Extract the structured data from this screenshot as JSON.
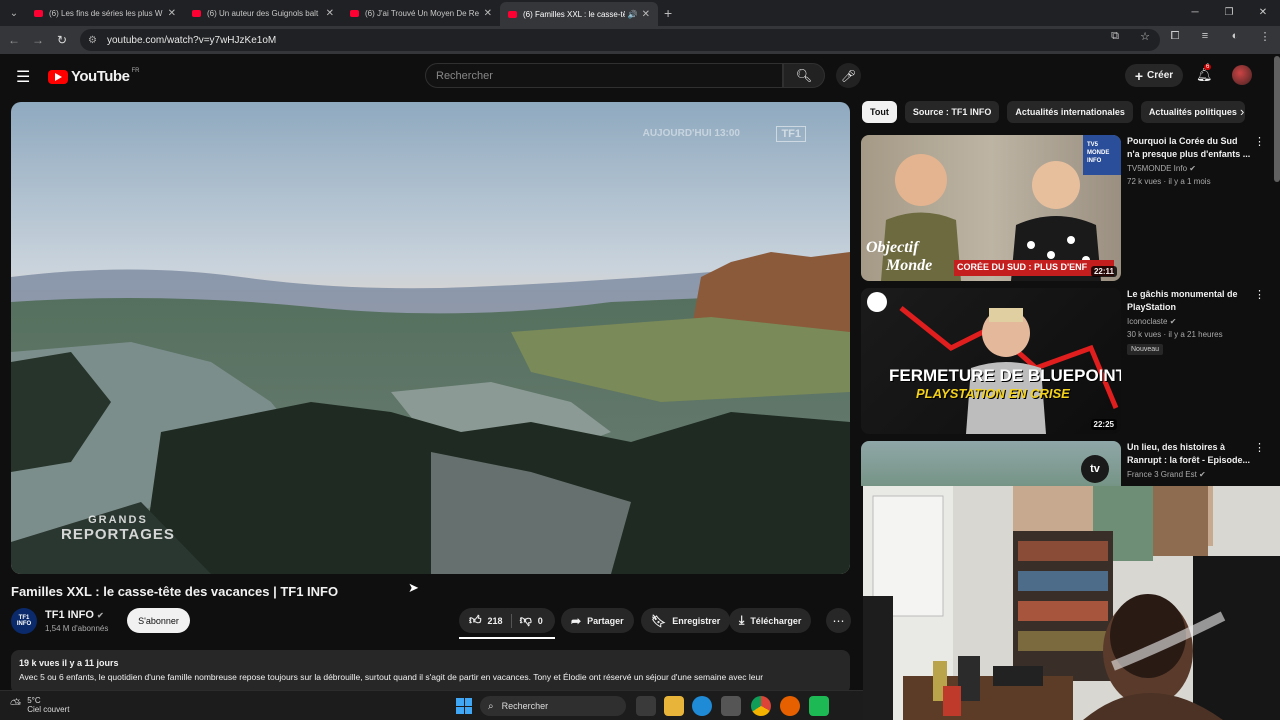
{
  "browser": {
    "tabs": [
      {
        "title": "(6) Les fins de séries les plus W"
      },
      {
        "title": "(6) Un auteur des Guignols balt"
      },
      {
        "title": "(6) J'ai Trouvé Un Moyen De Re"
      },
      {
        "title": "(6) Familles XXL : le casse-tê"
      }
    ],
    "url": "youtube.com/watch?v=y7wHJzKe1oM"
  },
  "youtube": {
    "logo_text": "YouTube",
    "region": "FR",
    "search_placeholder": "Rechercher",
    "create_label": "Créer",
    "notifications": "6"
  },
  "video": {
    "watermark": "AUJOURD'HUI 13:00",
    "watermark_channel": "TF1",
    "overlay_line1": "GRANDS",
    "overlay_line2": "REPORTAGES",
    "title": "Familles XXL : le casse-tête des vacances | TF1 INFO",
    "channel": "TF1 INFO",
    "channel_logo": "TF1 INFO",
    "subscribers": "1,54 M d'abonnés",
    "subscribe_label": "S'abonner",
    "likes": "218",
    "dislikes": "0",
    "share_label": "Partager",
    "save_label": "Enregistrer",
    "download_label": "Télécharger",
    "description_meta": "19 k vues  il y a 11 jours",
    "description_text": "Avec 5 ou 6 enfants, le quotidien d'une famille nombreuse repose toujours sur la débrouille, surtout quand il s'agit de partir en vacances. Tony et Élodie ont réservé un séjour d'une semaine avec leur"
  },
  "chips": [
    "Tout",
    "Source : TF1 INFO",
    "Actualités internationales",
    "Actualités politiques"
  ],
  "recommendations": [
    {
      "title": "Pourquoi la Corée du Sud n'a presque plus d'enfants ...",
      "channel": "TV5MONDE Info",
      "stats": "72 k vues · il y a 1 mois",
      "duration": "22:11",
      "thumb_text1": "Objectif",
      "thumb_text2": "Monde",
      "thumb_banner": "CORÉE DU SUD : PLUS D'ENFANTS ?",
      "thumb_logo": "TV5 MONDE INFO"
    },
    {
      "title": "Le gâchis monumental de PlayStation",
      "channel": "Iconoclaste",
      "stats": "30 k vues · il y a 21 heures",
      "badge": "Nouveau",
      "duration": "22:25",
      "thumb_text1": "FERMETURE DE BLUEPOINT",
      "thumb_text2": "PLAYSTATION EN CRISE"
    },
    {
      "title": "Un lieu, des histoires à Ranrupt : la forêt - Episode...",
      "channel": "France 3 Grand Est",
      "stats": "",
      "thumb_logo": "tv"
    }
  ],
  "taskbar": {
    "temperature": "5°C",
    "weather": "Ciel couvert",
    "search_label": "Rechercher"
  }
}
